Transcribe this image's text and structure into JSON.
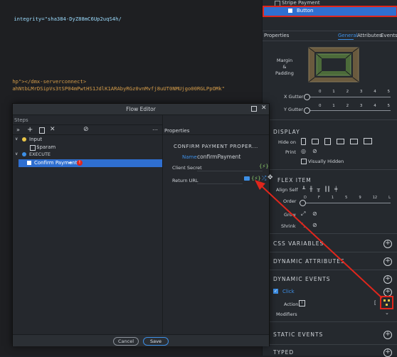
{
  "editor": {
    "lines": [
      {
        "text": "integrity=\"sha384-DyZ88mC6Up2uqS4h/"
      },
      {
        "text": "hp\"></dmx-serverconnect>"
      },
      {
        "text": "ahNtbLMrDSipVs3tSP04mPwtHS1JdlK1ARAbyRGz0vnMvfj8uUT0NMUjgo00RGLPpOMk\""
      }
    ]
  },
  "structure": {
    "stripe_payment": "Stripe Payment",
    "button": "Button"
  },
  "properties_panel": {
    "title": "Properties",
    "tabs": [
      "General",
      "Attributes",
      "Events"
    ],
    "active_tab": "General",
    "margin_label": "Margin",
    "and_label": "&",
    "padding_label": "Padding",
    "x_gutter_label": "X Gutter",
    "y_gutter_label": "Y Gutter",
    "gutter_ticks": [
      "0",
      "1",
      "2",
      "3",
      "4",
      "5"
    ],
    "display_title": "DISPLAY",
    "hide_on_label": "Hide on",
    "print_label": "Print",
    "visually_hidden_label": "Visually Hidden",
    "flex_item_title": "FLEX ITEM",
    "align_self_label": "Align Self",
    "order_label": "Order",
    "order_ticks": [
      "D",
      "F",
      "1",
      "5",
      "9",
      "12",
      "L"
    ],
    "grow_label": "Grow",
    "shrink_label": "Shrink",
    "css_variables_title": "CSS VARIABLES",
    "dynamic_attributes_title": "DYNAMIC ATTRIBUTES",
    "dynamic_events_title": "DYNAMIC EVENTS",
    "click_label": "Click",
    "action_label": "Action",
    "modifiers_label": "Modifiers",
    "static_events_title": "STATIC EVENTS",
    "typed_title": "TYPED",
    "accent_color": "#3d8fe6",
    "highlight_color": "#e0261c"
  },
  "flow_editor": {
    "title": "Flow Editor",
    "steps_label": "Steps",
    "tree": {
      "input": "Input",
      "param": "$param",
      "execute": "EXECUTE",
      "confirm_payment": "Confirm Payment"
    },
    "properties_label": "Properties",
    "section_title": "CONFIRM PAYMENT PROPER...",
    "name_label": "Name",
    "name_value": "confirmPayment",
    "client_secret_label": "Client Secret",
    "return_url_label": "Return URL",
    "cancel_label": "Cancel",
    "save_label": "Save"
  }
}
